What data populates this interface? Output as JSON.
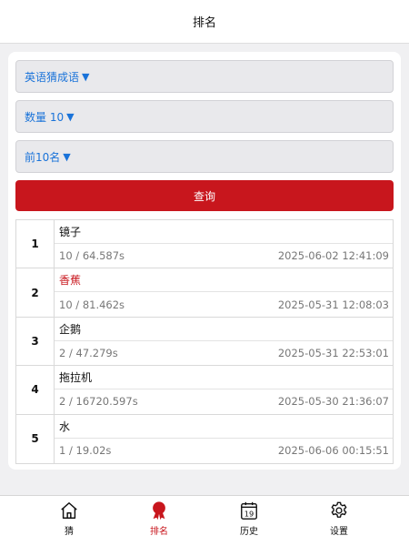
{
  "header": {
    "title": "排名"
  },
  "filters": {
    "category": {
      "label": "英语猜成语",
      "caret": "▼"
    },
    "count": {
      "label": "数量 10",
      "caret": "▼"
    },
    "top": {
      "label": "前10名",
      "caret": "▼"
    }
  },
  "query_button": {
    "label": "查询"
  },
  "rankings": [
    {
      "rank": "1",
      "word": "镜子",
      "score": "10 / 64.587s",
      "time": "2025-06-02 12:41:09",
      "highlight": false
    },
    {
      "rank": "2",
      "word": "香蕉",
      "score": "10 / 81.462s",
      "time": "2025-05-31 12:08:03",
      "highlight": true
    },
    {
      "rank": "3",
      "word": "企鹅",
      "score": "2 / 47.279s",
      "time": "2025-05-31 22:53:01",
      "highlight": false
    },
    {
      "rank": "4",
      "word": "拖拉机",
      "score": "2 / 16720.597s",
      "time": "2025-05-30 21:36:07",
      "highlight": false
    },
    {
      "rank": "5",
      "word": "水",
      "score": "1 / 19.02s",
      "time": "2025-06-06 00:15:51",
      "highlight": false
    }
  ],
  "tabbar": {
    "items": [
      {
        "label": "猜",
        "icon": "home-icon",
        "active": false
      },
      {
        "label": "排名",
        "icon": "award-icon",
        "active": true
      },
      {
        "label": "历史",
        "icon": "calendar-icon",
        "calendar_day": "19",
        "active": false
      },
      {
        "label": "设置",
        "icon": "gear-icon",
        "active": false
      }
    ]
  },
  "colors": {
    "accent": "#c8161d",
    "link": "#1a73d9"
  }
}
